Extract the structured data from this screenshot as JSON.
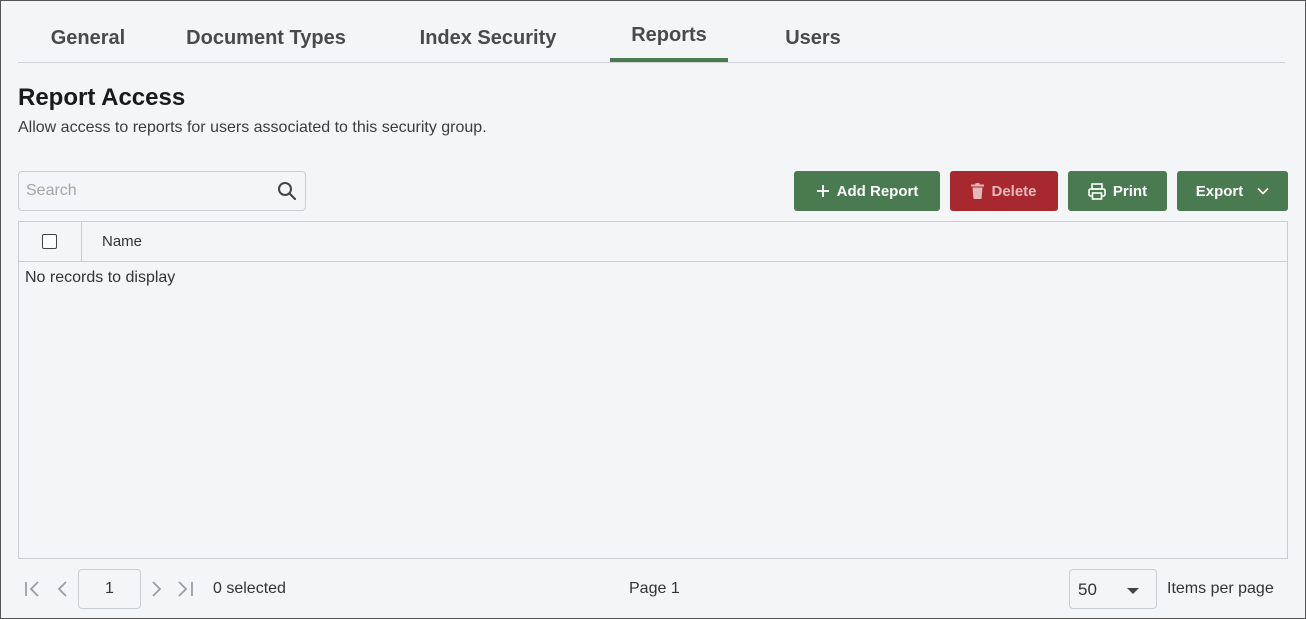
{
  "tabs": [
    {
      "label": "General",
      "active": false
    },
    {
      "label": "Document Types",
      "active": false
    },
    {
      "label": "Index Security",
      "active": false
    },
    {
      "label": "Reports",
      "active": true
    },
    {
      "label": "Users",
      "active": false
    }
  ],
  "section": {
    "title": "Report Access",
    "description": "Allow access to reports for users associated to this security group."
  },
  "search": {
    "placeholder": "Search",
    "value": "",
    "icon": "search-icon"
  },
  "toolbar": {
    "add_label": "Add Report",
    "delete_label": "Delete",
    "print_label": "Print",
    "export_label": "Export"
  },
  "grid": {
    "columns": [
      "Name"
    ],
    "rows": [],
    "empty_message": "No records to display"
  },
  "pager": {
    "current_page": "1",
    "selected_text": "0 selected",
    "page_text": "Page 1",
    "items_per_page_value": "50",
    "items_per_page_label": "Items per page"
  },
  "colors": {
    "primary": "#4a7a4f",
    "danger": "#a8282f",
    "background": "#f4f5f7"
  }
}
